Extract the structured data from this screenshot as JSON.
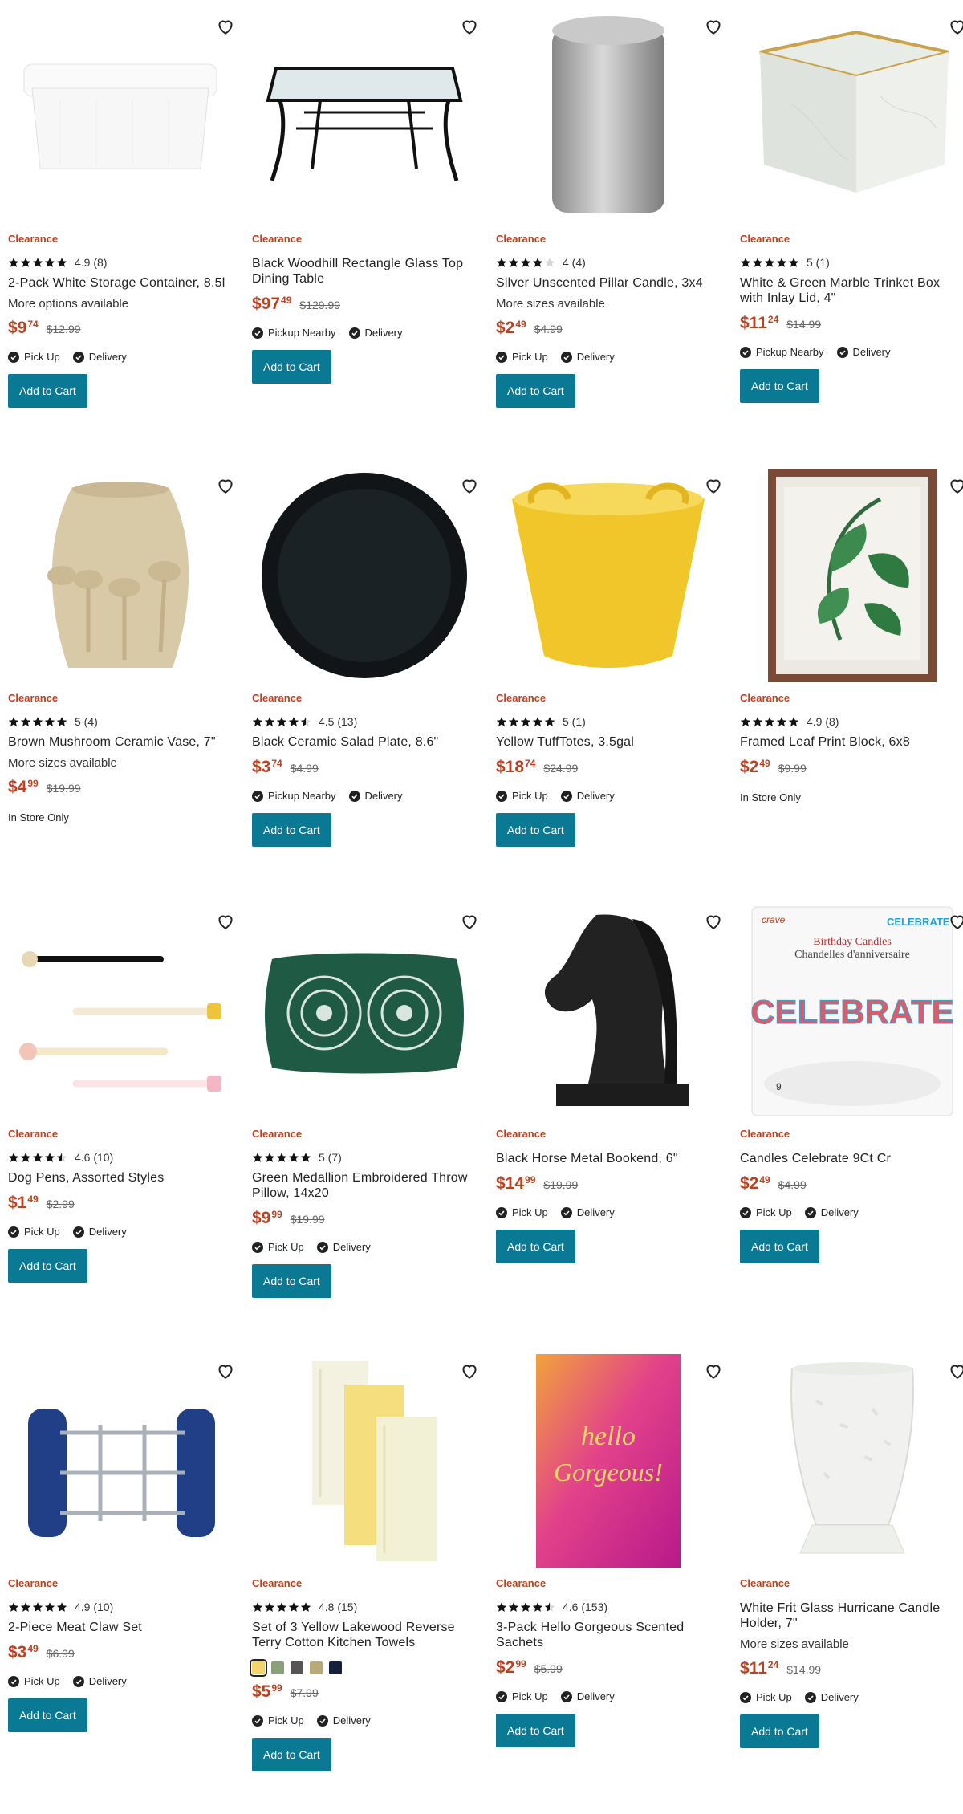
{
  "common": {
    "add_to_cart": "Add to Cart",
    "pick_up": "Pick Up",
    "pickup_nearby": "Pickup Nearby",
    "delivery": "Delivery",
    "in_store_only": "In Store Only"
  },
  "products": [
    {
      "badge": "Clearance",
      "stars": 5,
      "rating": "4.9 (8)",
      "name": "2-Pack White Storage Container, 8.5l",
      "more": "More options available",
      "price_main": "$9",
      "price_cents": "74",
      "old_price": "$12.99",
      "pickup": "Pick Up"
    },
    {
      "badge": "Clearance",
      "stars": 0,
      "rating": "",
      "name": "Black Woodhill Rectangle Glass Top Dining Table",
      "more": "",
      "price_main": "$97",
      "price_cents": "49",
      "old_price": "$129.99",
      "pickup": "Pickup Nearby"
    },
    {
      "badge": "Clearance",
      "stars": 4,
      "rating": "4 (4)",
      "name": "Silver Unscented Pillar Candle, 3x4",
      "more": "More sizes available",
      "price_main": "$2",
      "price_cents": "49",
      "old_price": "$4.99",
      "pickup": "Pick Up"
    },
    {
      "badge": "Clearance",
      "stars": 5,
      "rating": "5 (1)",
      "name": "White & Green Marble Trinket Box with Inlay Lid, 4\"",
      "more": "",
      "price_main": "$11",
      "price_cents": "24",
      "old_price": "$14.99",
      "pickup": "Pickup Nearby"
    },
    {
      "badge": "Clearance",
      "stars": 5,
      "rating": "5 (4)",
      "name": "Brown Mushroom Ceramic Vase, 7\"",
      "more": "More sizes available",
      "price_main": "$4",
      "price_cents": "99",
      "old_price": "$19.99",
      "pickup": "",
      "in_store": true
    },
    {
      "badge": "Clearance",
      "stars": 4.5,
      "rating": "4.5 (13)",
      "name": "Black Ceramic Salad Plate, 8.6\"",
      "more": "",
      "price_main": "$3",
      "price_cents": "74",
      "old_price": "$4.99",
      "pickup": "Pickup Nearby"
    },
    {
      "badge": "Clearance",
      "stars": 5,
      "rating": "5 (1)",
      "name": "Yellow TuffTotes, 3.5gal",
      "more": "",
      "price_main": "$18",
      "price_cents": "74",
      "old_price": "$24.99",
      "pickup": "Pick Up"
    },
    {
      "badge": "Clearance",
      "stars": 5,
      "rating": "4.9 (8)",
      "name": "Framed Leaf Print Block, 6x8",
      "more": "",
      "price_main": "$2",
      "price_cents": "49",
      "old_price": "$9.99",
      "pickup": "",
      "in_store": true
    },
    {
      "badge": "Clearance",
      "stars": 4.5,
      "rating": "4.6 (10)",
      "name": "Dog Pens, Assorted Styles",
      "more": "",
      "price_main": "$1",
      "price_cents": "49",
      "old_price": "$2.99",
      "pickup": "Pick Up"
    },
    {
      "badge": "Clearance",
      "stars": 5,
      "rating": "5 (7)",
      "name": "Green Medallion Embroidered Throw Pillow, 14x20",
      "more": "",
      "price_main": "$9",
      "price_cents": "99",
      "old_price": "$19.99",
      "pickup": "Pick Up"
    },
    {
      "badge": "Clearance",
      "stars": 0,
      "rating": "",
      "name": "Black Horse Metal Bookend, 6\"",
      "more": "",
      "price_main": "$14",
      "price_cents": "99",
      "old_price": "$19.99",
      "pickup": "Pick Up"
    },
    {
      "badge": "Clearance",
      "stars": 0,
      "rating": "",
      "name": "Candles Celebrate 9Ct Cr",
      "more": "",
      "price_main": "$2",
      "price_cents": "49",
      "old_price": "$4.99",
      "pickup": "Pick Up",
      "img_text": {
        "brand": "crave",
        "word": "CELEBRATE",
        "line1": "Birthday Candles",
        "line2": "Chandelles d'anniversaire",
        "big": "CELEBRATE",
        "count": "9"
      }
    },
    {
      "badge": "Clearance",
      "stars": 5,
      "rating": "4.9 (10)",
      "name": "2-Piece Meat Claw Set",
      "more": "",
      "price_main": "$3",
      "price_cents": "49",
      "old_price": "$6.99",
      "pickup": "Pick Up"
    },
    {
      "badge": "Clearance",
      "stars": 5,
      "rating": "4.8 (15)",
      "name": "Set of 3 Yellow Lakewood Reverse Terry Cotton Kitchen Towels",
      "more": "",
      "price_main": "$5",
      "price_cents": "99",
      "old_price": "$7.99",
      "pickup": "Pick Up",
      "swatches": [
        "#f2d46a",
        "#8aa07a",
        "#555555",
        "#b8a978",
        "#14213d"
      ]
    },
    {
      "badge": "Clearance",
      "stars": 4.5,
      "rating": "4.6 (153)",
      "name": "3-Pack Hello Gorgeous Scented Sachets",
      "more": "",
      "price_main": "$2",
      "price_cents": "99",
      "old_price": "$5.99",
      "pickup": "Pick Up",
      "img_text": {
        "line1": "hello",
        "line2": "Gorgeous!"
      }
    },
    {
      "badge": "Clearance",
      "stars": 0,
      "rating": "",
      "name": "White Frit Glass Hurricane Candle Holder, 7\"",
      "more": "More sizes available",
      "price_main": "$11",
      "price_cents": "24",
      "old_price": "$14.99",
      "pickup": "Pick Up"
    }
  ]
}
